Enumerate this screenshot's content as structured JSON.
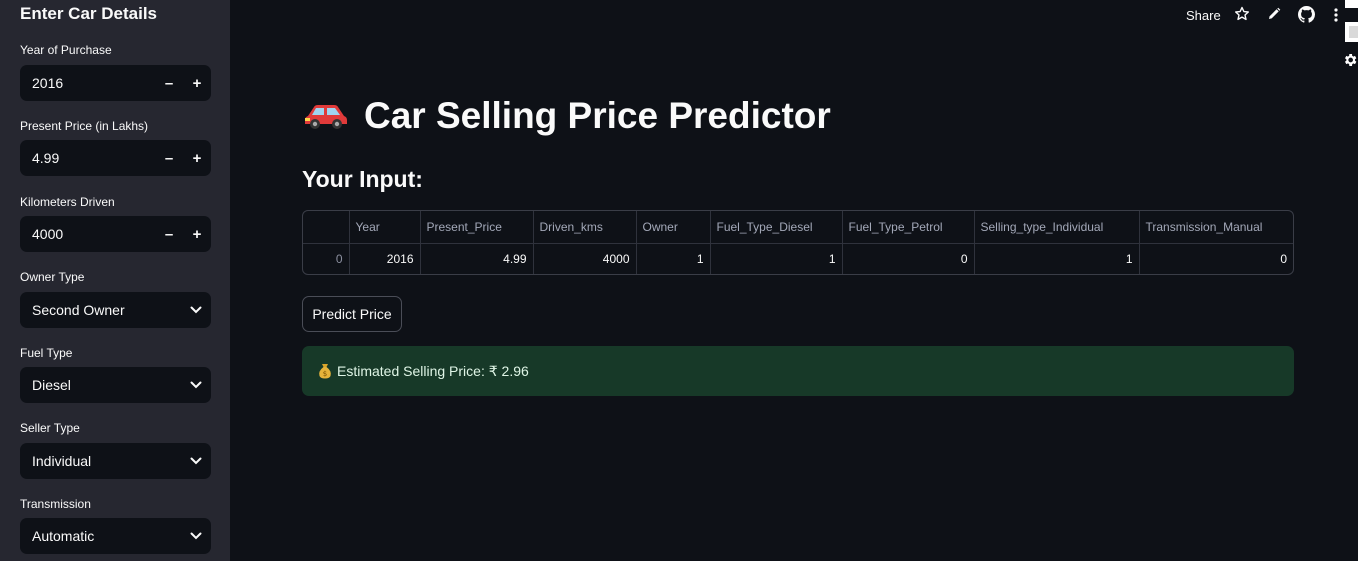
{
  "sidebar": {
    "title": "Enter Car Details",
    "year": {
      "label": "Year of Purchase",
      "value": "2016"
    },
    "present_price": {
      "label": "Present Price (in Lakhs)",
      "value": "4.99"
    },
    "kms": {
      "label": "Kilometers Driven",
      "value": "4000"
    },
    "owner": {
      "label": "Owner Type",
      "value": "Second Owner"
    },
    "fuel": {
      "label": "Fuel Type",
      "value": "Diesel"
    },
    "seller": {
      "label": "Seller Type",
      "value": "Individual"
    },
    "transmission": {
      "label": "Transmission",
      "value": "Automatic"
    },
    "minus_symbol": "–",
    "plus_symbol": "+"
  },
  "toolbar": {
    "share_label": "Share",
    "icons": [
      "star-icon",
      "pencil-icon",
      "github-icon",
      "more-vert-icon",
      "gear-icon"
    ]
  },
  "main": {
    "title": "Car Selling Price Predictor",
    "input_heading": "Your Input:",
    "table": {
      "headers": [
        "",
        "Year",
        "Present_Price",
        "Driven_kms",
        "Owner",
        "Fuel_Type_Diesel",
        "Fuel_Type_Petrol",
        "Selling_type_Individual",
        "Transmission_Manual"
      ],
      "row": [
        "0",
        "2016",
        "4.99",
        "4000",
        "1",
        "1",
        "0",
        "1",
        "0"
      ]
    },
    "predict_label": "Predict Price",
    "result_text": "Estimated Selling Price: ₹ 2.96"
  },
  "colors": {
    "background": "#0e1117",
    "sidebar": "#262730",
    "success": "#173928",
    "text": "#fafafa"
  }
}
